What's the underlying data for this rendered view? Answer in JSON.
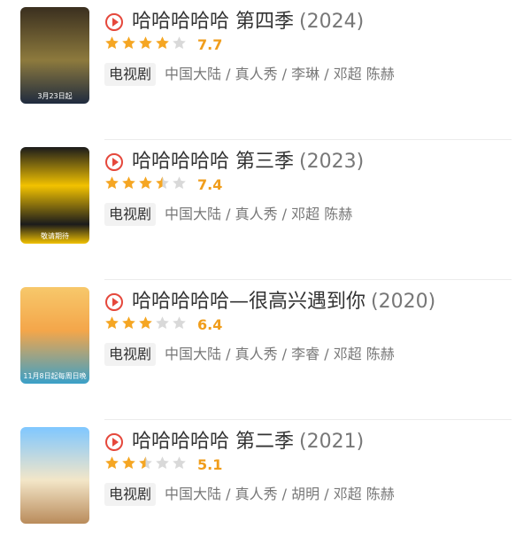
{
  "items": [
    {
      "title": "哈哈哈哈哈 第四季",
      "year": "(2024)",
      "rating_stars": 4,
      "rating": "7.7",
      "tag": "电视剧",
      "meta": "中国大陆 / 真人秀 / 李琳 / 邓超 陈赫",
      "poster_caption": "3月23日起"
    },
    {
      "title": "哈哈哈哈哈 第三季",
      "year": "(2023)",
      "rating_stars": 3.5,
      "rating": "7.4",
      "tag": "电视剧",
      "meta": "中国大陆 / 真人秀 / 邓超 陈赫",
      "poster_caption": "敬请期待"
    },
    {
      "title": "哈哈哈哈哈—很高兴遇到你",
      "year": "(2020)",
      "rating_stars": 3,
      "rating": "6.4",
      "tag": "电视剧",
      "meta": "中国大陆 / 真人秀 / 李睿 / 邓超 陈赫",
      "poster_caption": "11月8日起每周日晚"
    },
    {
      "title": "哈哈哈哈哈 第二季",
      "year": "(2021)",
      "rating_stars": 2.5,
      "rating": "5.1",
      "tag": "电视剧",
      "meta": "中国大陆 / 真人秀 / 胡明 / 邓超 陈赫",
      "poster_caption": ""
    }
  ],
  "colors": {
    "star": "#f5a623",
    "star_empty": "#d9d9d9",
    "play": "#e5483c",
    "score": "#f09d1b"
  },
  "icons": {
    "play": "play-circle-icon",
    "star": "star-icon"
  }
}
